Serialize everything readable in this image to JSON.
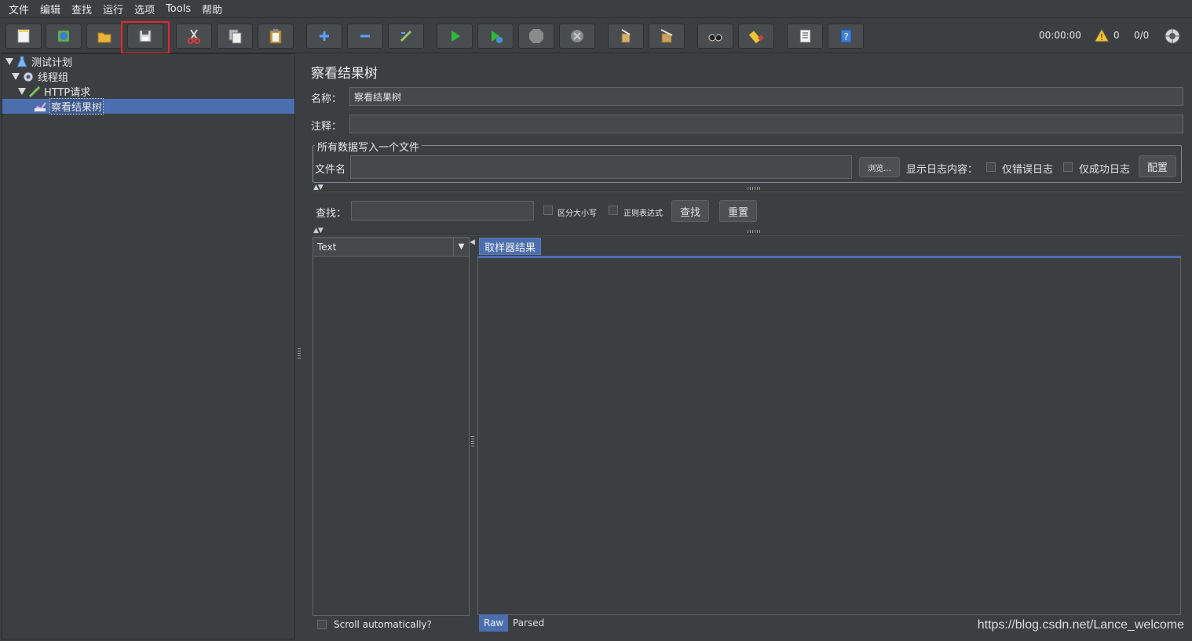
{
  "menu": [
    "文件",
    "编辑",
    "查找",
    "运行",
    "选项",
    "Tools",
    "帮助"
  ],
  "toolbar_icons": [
    "new-icon",
    "templates-icon",
    "open-icon",
    "save-icon",
    "cut-icon",
    "copy-icon",
    "paste-icon",
    "expand-icon",
    "collapse-icon",
    "toggle-icon",
    "start-icon",
    "start-no-pause-icon",
    "stop-icon",
    "shutdown-icon",
    "clear-icon",
    "clear-all-icon",
    "search-icon",
    "reset-search-icon",
    "function-helper-icon",
    "help-icon"
  ],
  "status": {
    "timer": "00:00:00",
    "warnings": "0",
    "threads": "0/0"
  },
  "tree": [
    {
      "label": "测试计划",
      "icon": "test-plan-icon"
    },
    {
      "label": "线程组",
      "icon": "thread-group-icon"
    },
    {
      "label": "HTTP请求",
      "icon": "http-sampler-icon"
    },
    {
      "label": "察看结果树",
      "icon": "listener-icon"
    }
  ],
  "panel": {
    "title": "察看结果树",
    "name_label": "名称：",
    "name_value": "察看结果树",
    "comment_label": "注释：",
    "comment_value": "",
    "file_group_title": "所有数据写入一个文件",
    "filename_label": "文件名",
    "filename_value": "",
    "browse_label": "浏览...",
    "log_label": "显示日志内容：",
    "errors_only_label": "仅错误日志",
    "success_only_label": "仅成功日志",
    "configure_label": "配置",
    "search_label": "查找：",
    "search_value": "",
    "case_label": "区分大小写",
    "regex_label": "正则表达式",
    "find_button": "查找",
    "reset_button": "重置",
    "renderer_selected": "Text",
    "scroll_auto_label": "Scroll automatically?",
    "sampler_tab": "取样器结果",
    "raw_tab": "Raw",
    "parsed_tab": "Parsed"
  },
  "watermark": "https://blog.csdn.net/Lance_welcome",
  "colors": {
    "background": "#3c3f41",
    "selection": "#4b6eaf",
    "highlight": "#e8262c"
  }
}
